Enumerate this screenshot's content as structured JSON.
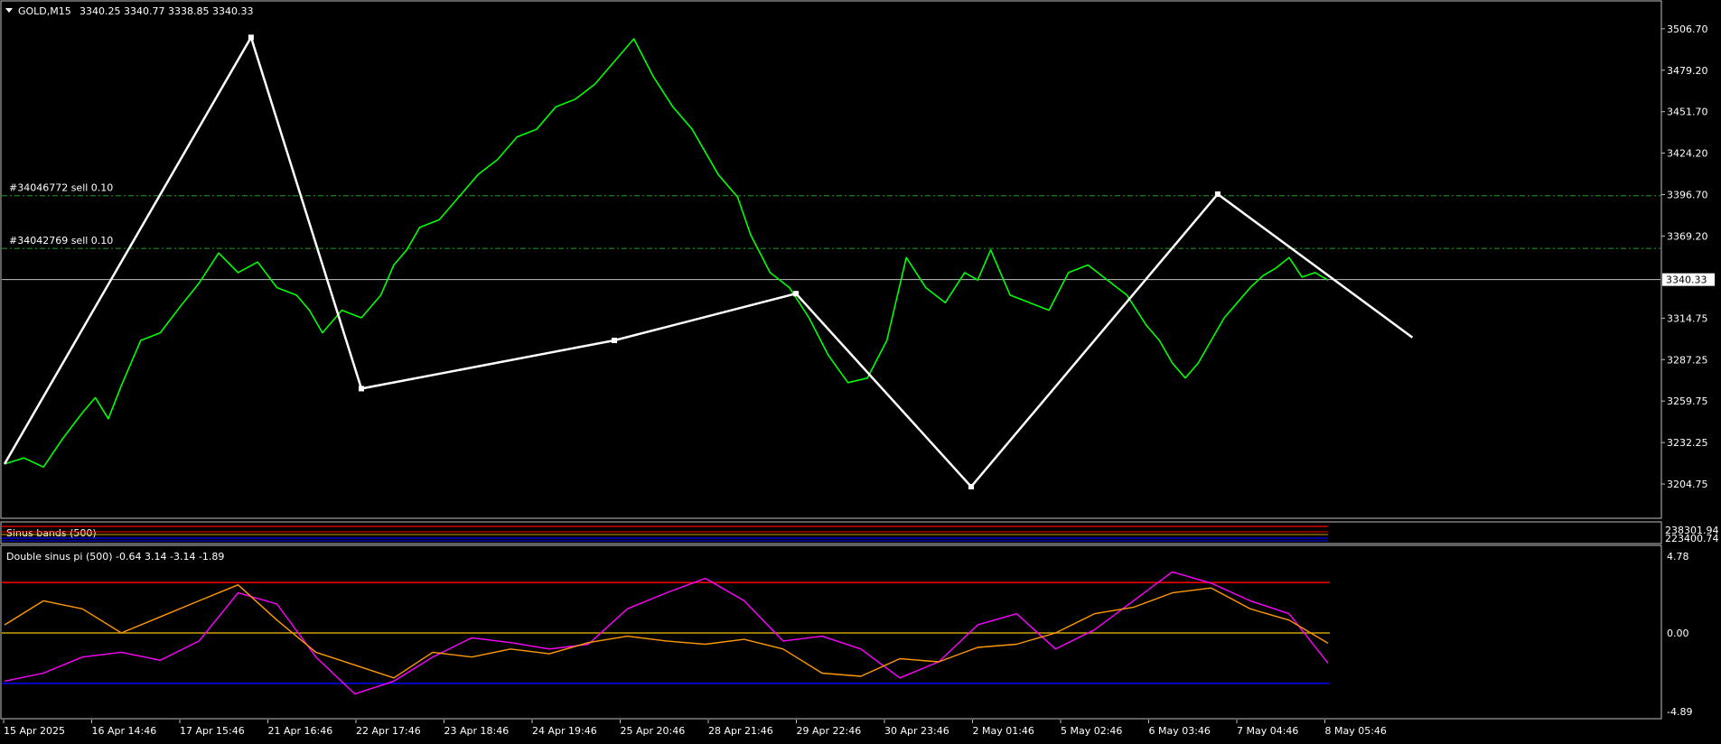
{
  "header": {
    "symbol": "GOLD,M15",
    "ohlc": "3340.25 3340.77 3338.85 3340.33"
  },
  "colors": {
    "background": "#000000",
    "frame": "#bfbfbf",
    "price": "#00ff00",
    "zigzag": "#ffffff",
    "order_line": "#1fa01f",
    "band_red": "#ff0000",
    "band_blue": "#0000ff",
    "band_gold": "#c8a000",
    "osc_magenta": "#ff00ff",
    "osc_orange": "#ff9900"
  },
  "chart_data": [
    {
      "type": "line",
      "title": "GOLD,M15",
      "ylim": [
        3191.0,
        3515.0
      ],
      "y_ticks": [
        "3506.70",
        "3479.20",
        "3451.70",
        "3424.20",
        "3396.70",
        "3369.20",
        "3340.33",
        "3314.75",
        "3287.25",
        "3259.75",
        "3232.25",
        "3204.75"
      ],
      "current_price": 3340.33,
      "current_label": "3340.33",
      "x_tick_labels": [
        "15 Apr 2025",
        "16 Apr 14:46",
        "17 Apr 15:46",
        "21 Apr 16:46",
        "22 Apr 17:46",
        "23 Apr 18:46",
        "24 Apr 19:46",
        "25 Apr 20:46",
        "28 Apr 21:46",
        "29 Apr 22:46",
        "30 Apr 23:46",
        "2 May 01:46",
        "5 May 02:46",
        "6 May 03:46",
        "7 May 04:46",
        "8 May 05:46"
      ],
      "series": [
        {
          "x": [
            0,
            3,
            6,
            9,
            12,
            14,
            16,
            18,
            21,
            24,
            27,
            30,
            33,
            36,
            39,
            42,
            45,
            47,
            49,
            52,
            55,
            58,
            60,
            62,
            64,
            67,
            70,
            73,
            76,
            79,
            82,
            85,
            88,
            91,
            94,
            97,
            100,
            103,
            106,
            110,
            113,
            115,
            118,
            121,
            124,
            127,
            130,
            133,
            136,
            139,
            142,
            145,
            148,
            150,
            152,
            155,
            158,
            161,
            164,
            167,
            170,
            173,
            176,
            178,
            180,
            182,
            184,
            186,
            188,
            190,
            192,
            194,
            196,
            198,
            200,
            202,
            204
          ],
          "values": [
            3218,
            3222,
            3216,
            3235,
            3252,
            3262,
            3248,
            3270,
            3300,
            3305,
            3322,
            3338,
            3358,
            3345,
            3352,
            3335,
            3330,
            3320,
            3305,
            3320,
            3315,
            3330,
            3350,
            3360,
            3375,
            3380,
            3395,
            3410,
            3420,
            3435,
            3440,
            3455,
            3460,
            3470,
            3485,
            3500,
            3475,
            3455,
            3440,
            3410,
            3395,
            3370,
            3345,
            3335,
            3315,
            3290,
            3272,
            3275,
            3300,
            3355,
            3335,
            3325,
            3345,
            3340,
            3360,
            3330,
            3325,
            3320,
            3345,
            3350,
            3340,
            3330,
            3310,
            3300,
            3285,
            3275,
            3285,
            3300,
            3315,
            3325,
            3335,
            3343,
            3348,
            3355,
            3342,
            3345,
            3340
          ],
          "name": ""
        }
      ],
      "zigzag": [
        {
          "x": 0,
          "y": 3218
        },
        {
          "x": 38,
          "y": 3501
        },
        {
          "x": 55,
          "y": 3268
        },
        {
          "x": 94,
          "y": 3300
        },
        {
          "x": 122,
          "y": 3331
        },
        {
          "x": 149,
          "y": 3203
        },
        {
          "x": 187,
          "y": 3397
        },
        {
          "x": 217,
          "y": 3302
        }
      ],
      "order_lines": [
        {
          "label": "#34046772 sell 0.10",
          "price": 3396.0
        },
        {
          "label": "#34042769 sell 0.10",
          "price": 3361.0
        }
      ]
    },
    {
      "type": "line",
      "title": "Sinus bands (500)",
      "tick_labels": [
        "238301.94",
        "223400.74"
      ]
    },
    {
      "type": "line",
      "title": "Double sinus pi (500) -0.64 3.14 -3.14 -1.89",
      "ylim": [
        -4.89,
        4.78
      ],
      "y_ticks": [
        "4.78",
        "0.00",
        "-4.89"
      ],
      "levels": [
        3.14,
        0.0,
        -3.14
      ],
      "series": [
        {
          "x": [
            0,
            6,
            12,
            18,
            24,
            30,
            36,
            42,
            48,
            54,
            60,
            66,
            72,
            78,
            84,
            90,
            96,
            102,
            108,
            114,
            120,
            126,
            132,
            138,
            144,
            150,
            156,
            162,
            168,
            174,
            180,
            186,
            192,
            198,
            204
          ],
          "values": [
            -3.0,
            -2.5,
            -1.5,
            -1.2,
            -1.7,
            -0.5,
            2.5,
            1.8,
            -1.5,
            -3.8,
            -3.0,
            -1.5,
            -0.3,
            -0.6,
            -1.0,
            -0.7,
            1.5,
            2.5,
            3.4,
            2.0,
            -0.5,
            -0.2,
            -1.0,
            -2.8,
            -1.8,
            0.5,
            1.2,
            -1.0,
            0.2,
            2.0,
            3.8,
            3.1,
            2.0,
            1.2,
            -1.89
          ],
          "name": ""
        },
        {
          "x": [
            0,
            6,
            12,
            18,
            24,
            30,
            36,
            42,
            48,
            54,
            60,
            66,
            72,
            78,
            84,
            90,
            96,
            102,
            108,
            114,
            120,
            126,
            132,
            138,
            144,
            150,
            156,
            162,
            168,
            174,
            180,
            186,
            192,
            198,
            204
          ],
          "values": [
            0.5,
            2.0,
            1.5,
            0.0,
            1.0,
            2.0,
            3.0,
            0.8,
            -1.2,
            -2.0,
            -2.8,
            -1.2,
            -1.5,
            -1.0,
            -1.3,
            -0.6,
            -0.2,
            -0.5,
            -0.7,
            -0.4,
            -1.0,
            -2.5,
            -2.7,
            -1.6,
            -1.8,
            -0.9,
            -0.7,
            0.0,
            1.2,
            1.6,
            2.5,
            2.8,
            1.5,
            0.8,
            -0.64
          ],
          "name": ""
        }
      ]
    }
  ]
}
